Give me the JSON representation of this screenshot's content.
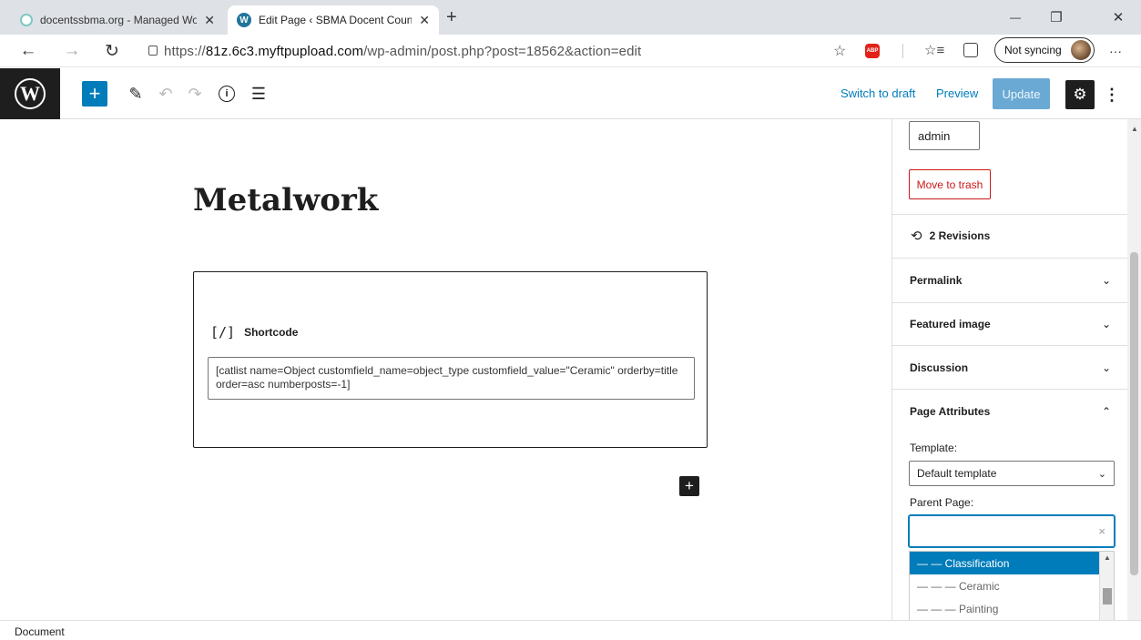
{
  "browser": {
    "tabs": [
      {
        "title": "docentssbma.org - Managed Wo",
        "close": "✕"
      },
      {
        "title": "Edit Page ‹ SBMA Docent Counc",
        "close": "✕"
      }
    ],
    "new_tab": "+",
    "window": {
      "minimize": "—",
      "restore": "❐",
      "close": "✕"
    },
    "nav": {
      "back": "←",
      "forward": "→",
      "reload": "↻"
    },
    "url_prefix": "https://",
    "url_host": "81z.6c3.myftpupload.com",
    "url_path": "/wp-admin/post.php?post=18562&action=edit",
    "sync_label": "Not syncing",
    "menu": "···",
    "abp": "ABP"
  },
  "wp_toolbar": {
    "logo": "W",
    "add": "+",
    "switch_to_draft": "Switch to draft",
    "preview": "Preview",
    "update": "Update",
    "settings": "⚙",
    "more": "⋮"
  },
  "editor": {
    "title": "Metalwork",
    "block_label": "Shortcode",
    "block_icon": "[/]",
    "shortcode": "[catlist name=Object customfield_name=object_type customfield_value=\"Ceramic\" orderby=title order=asc numberposts=-1]",
    "inserter": "+"
  },
  "sidebar": {
    "author": "admin",
    "move_to_trash": "Move to trash",
    "revisions": "2 Revisions",
    "panels": [
      "Permalink",
      "Featured image",
      "Discussion",
      "Page Attributes"
    ],
    "template_label": "Template:",
    "template_value": "Default template",
    "parent_label": "Parent Page:",
    "parent_value": "",
    "clear": "×",
    "options": [
      "— — Classification",
      "— — — Ceramic",
      "— — — Painting"
    ]
  },
  "footer": {
    "breadcrumb": "Document"
  },
  "colors": {
    "accent": "#007cba",
    "danger": "#cc1818",
    "dark": "#1e1e1e"
  }
}
